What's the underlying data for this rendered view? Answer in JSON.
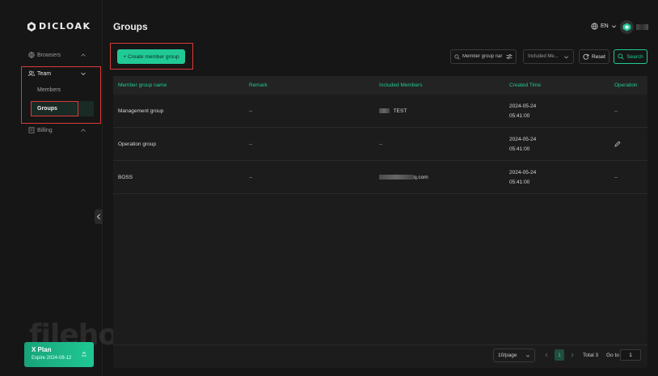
{
  "app": {
    "brand": "DICLOAK"
  },
  "sidebar": {
    "items": [
      {
        "label": "Browsers"
      },
      {
        "label": "Team",
        "children": [
          {
            "label": "Members"
          },
          {
            "label": "Groups"
          }
        ]
      },
      {
        "label": "Billing"
      }
    ]
  },
  "plan": {
    "name": "X Plan",
    "expire": "Expire 2024-08-12"
  },
  "header": {
    "title": "Groups",
    "language": "EN"
  },
  "toolbar": {
    "create_label": "+ Create member group",
    "search_placeholder": "Member group nar",
    "included_placeholder": "Included Me...",
    "reset_label": "Reset",
    "search_label": "Search"
  },
  "table": {
    "columns": [
      "Member group name",
      "Remark",
      "Included Members",
      "Created Time",
      "Operation"
    ],
    "rows": [
      {
        "name": "Management group",
        "remark": "--",
        "members": "TEST",
        "date": "2024-05-24",
        "time": "05:41:00",
        "operation": "--"
      },
      {
        "name": "Operation group",
        "remark": "--",
        "members": "--",
        "date": "2024-05-24",
        "time": "05:41:00",
        "operation": "edit-icon"
      },
      {
        "name": "BOSS",
        "remark": "--",
        "members": "q.com",
        "date": "2024-05-24",
        "time": "05:41:00",
        "operation": "--"
      }
    ]
  },
  "pagination": {
    "page_size": "10/page",
    "current_page": "1",
    "total": "Total 3",
    "goto_label": "Go to",
    "goto_value": "1"
  },
  "colors": {
    "accent": "#21c995",
    "highlight": "#d93a3a",
    "background": "#161616"
  }
}
